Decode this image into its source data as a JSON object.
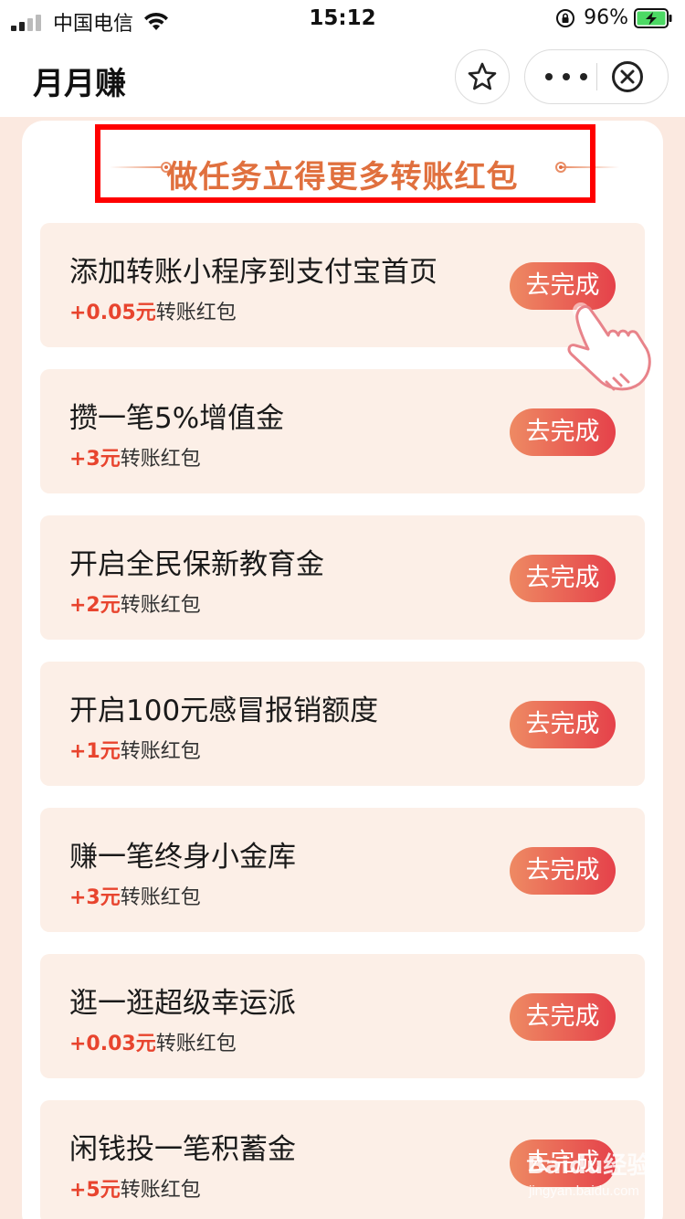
{
  "status_bar": {
    "carrier": "中国电信",
    "time": "15:12",
    "battery_percent": "96%"
  },
  "nav": {
    "title": "月月赚"
  },
  "heading": "做任务立得更多转账红包",
  "tasks": [
    {
      "title": "添加转账小程序到支付宝首页",
      "amount": "+0.05元",
      "reward_suffix": "转账红包",
      "button": "去完成"
    },
    {
      "title": "攒一笔5%增值金",
      "amount": "+3元",
      "reward_suffix": "转账红包",
      "button": "去完成"
    },
    {
      "title": "开启全民保新教育金",
      "amount": "+2元",
      "reward_suffix": "转账红包",
      "button": "去完成"
    },
    {
      "title": "开启100元感冒报销额度",
      "amount": "+1元",
      "reward_suffix": "转账红包",
      "button": "去完成"
    },
    {
      "title": "赚一笔终身小金库",
      "amount": "+3元",
      "reward_suffix": "转账红包",
      "button": "去完成"
    },
    {
      "title": "逛一逛超级幸运派",
      "amount": "+0.03元",
      "reward_suffix": "转账红包",
      "button": "去完成"
    },
    {
      "title": "闲钱投一笔积蓄金",
      "amount": "+5元",
      "reward_suffix": "转账红包",
      "button": "去完成"
    }
  ],
  "watermark": {
    "main": "Baidu经验",
    "sub": "jingyan.baidu.com"
  },
  "colors": {
    "accent": "#e0703e",
    "reward_red": "#e8442e",
    "card_bg": "#fcefe7",
    "highlight_box": "#ff0000"
  }
}
